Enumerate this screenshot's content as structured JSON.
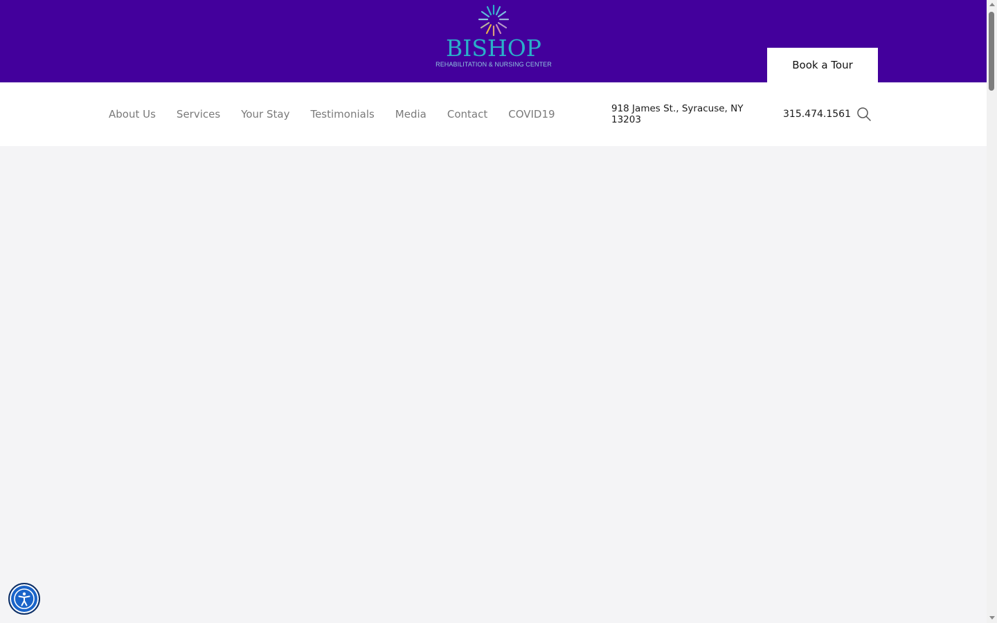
{
  "brand": {
    "name": "BISHOP",
    "tagline": "REHABILITATION & NURSING CENTER",
    "logo_colors": [
      "#2ab0c9",
      "#8fc8de",
      "#c98ab5",
      "#e6b24a"
    ],
    "topbar_color": "#43009c"
  },
  "header": {
    "book_label": "Book a Tour"
  },
  "nav": {
    "items": [
      {
        "label": "About Us"
      },
      {
        "label": "Services"
      },
      {
        "label": "Your Stay"
      },
      {
        "label": "Testimonials"
      },
      {
        "label": "Media"
      },
      {
        "label": "Contact"
      },
      {
        "label": "COVID19"
      }
    ],
    "address": "918 James St., Syracuse, NY 13203",
    "phone": "315.474.1561",
    "search_icon": "search-icon"
  },
  "accessibility": {
    "icon": "accessibility-icon",
    "color": "#1a64c9"
  }
}
